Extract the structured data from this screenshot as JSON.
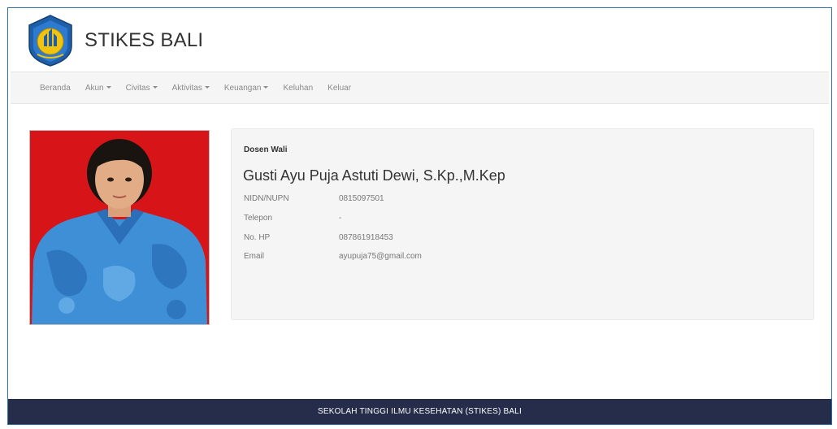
{
  "header": {
    "title": "STIKES BALI",
    "logo_icon": "stikes-bali-logo"
  },
  "nav": {
    "items": [
      {
        "label": "Beranda",
        "dropdown": false
      },
      {
        "label": "Akun",
        "dropdown": true
      },
      {
        "label": "Civitas",
        "dropdown": true
      },
      {
        "label": "Aktivitas",
        "dropdown": true
      },
      {
        "label": "Keuangan",
        "dropdown": true
      },
      {
        "label": "Keluhan",
        "dropdown": false
      },
      {
        "label": "Keluar",
        "dropdown": false
      }
    ]
  },
  "profile": {
    "heading": "Dosen Wali",
    "name": "Gusti Ayu Puja Astuti Dewi, S.Kp.,M.Kep",
    "fields": [
      {
        "label": "NIDN/NUPN",
        "value": "0815097501"
      },
      {
        "label": "Telepon",
        "value": "-"
      },
      {
        "label": "No. HP",
        "value": "087861918453"
      },
      {
        "label": "Email",
        "value": "ayupuja75@gmail.com"
      }
    ]
  },
  "footer": {
    "text": "SEKOLAH TINGGI ILMU KESEHATAN (STIKES) BALI"
  },
  "colors": {
    "footer_bg": "#252d4a",
    "photo_bg": "#d71518",
    "frame_border": "#2f6fa8"
  }
}
